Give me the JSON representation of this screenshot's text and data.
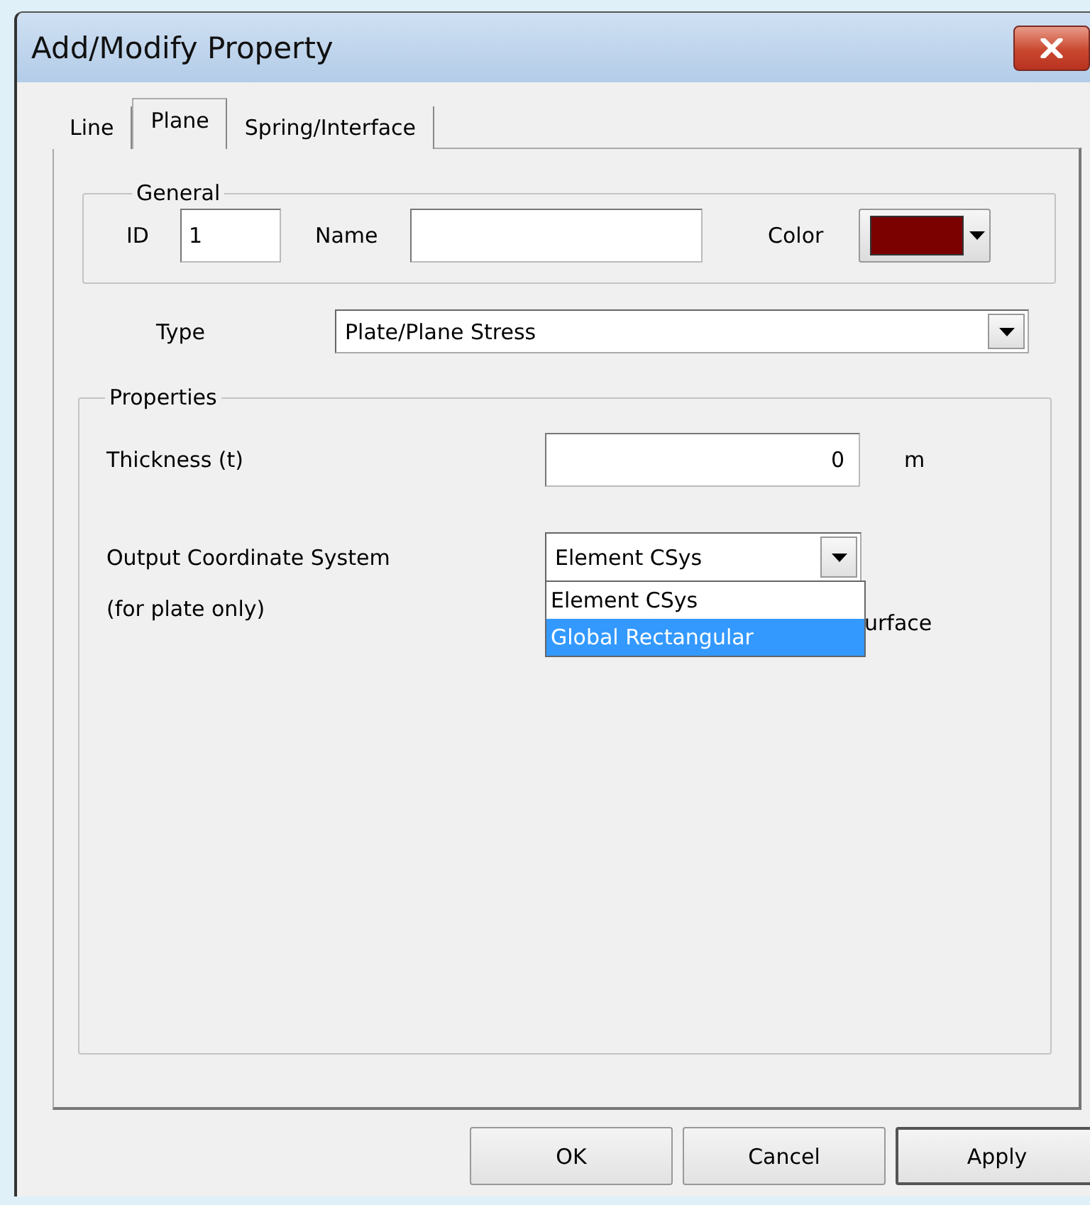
{
  "window": {
    "title": "Add/Modify Property"
  },
  "tabs": [
    {
      "label": "Line",
      "selected": false
    },
    {
      "label": "Plane",
      "selected": true
    },
    {
      "label": "Spring/Interface",
      "selected": false
    }
  ],
  "general": {
    "legend": "General",
    "id_label": "ID",
    "id_value": "1",
    "name_label": "Name",
    "color_label": "Color",
    "color": "#7b0000"
  },
  "type": {
    "label": "Type",
    "value": "Plate/Plane Stress"
  },
  "properties": {
    "legend": "Properties",
    "thickness": {
      "label": "Thickness (t)",
      "value": "0",
      "unit": "m"
    },
    "output": {
      "label": "Output Coordinate System",
      "note": "(for plate only)",
      "value": "Element CSys",
      "expanded": true,
      "options": [
        {
          "label": "Element CSys",
          "highlighted": false
        },
        {
          "label": "Global Rectangular",
          "highlighted": true
        }
      ]
    },
    "partial_label": "urface"
  },
  "buttons": [
    {
      "label": "OK",
      "default": false
    },
    {
      "label": "Cancel",
      "default": false
    },
    {
      "label": "Apply",
      "default": true
    }
  ]
}
